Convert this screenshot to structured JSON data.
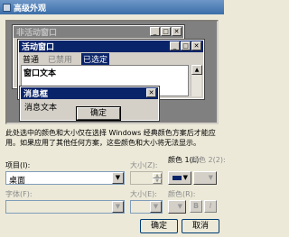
{
  "window": {
    "title": "高级外观"
  },
  "preview": {
    "inactive_window": {
      "title": "非活动窗口"
    },
    "active_window": {
      "title": "活动窗口",
      "menu": {
        "normal": "普通",
        "disabled": "已禁用",
        "selected": "已选定"
      },
      "text": "窗口文本"
    },
    "message_box": {
      "title": "消息框",
      "text": "消息文本",
      "ok_label": "确定"
    },
    "caption_buttons": {
      "minimize": "_",
      "maximize": "□",
      "close": "✕"
    }
  },
  "description": "此处选中的颜色和大小仅在选择 Windows 经典颜色方案后才能应用。如果应用了其他任何方案，这些颜色和大小将无法显示。",
  "item": {
    "label": "项目(I):",
    "value": "桌面",
    "size_label": "大小(Z):",
    "color1_label": "颜色 1(L):",
    "color2_label": "颜色 2(2):",
    "color1": "#0a246a"
  },
  "font": {
    "label": "字体(F):",
    "value": "",
    "size_label": "大小(E):",
    "color_label": "颜色(R):",
    "bold": "B",
    "italic": "I"
  },
  "buttons": {
    "ok": "确定",
    "cancel": "取消"
  },
  "colors": {
    "active_caption": "#0a246a",
    "inactive_caption": "#808080",
    "face": "#d4d0c8"
  }
}
